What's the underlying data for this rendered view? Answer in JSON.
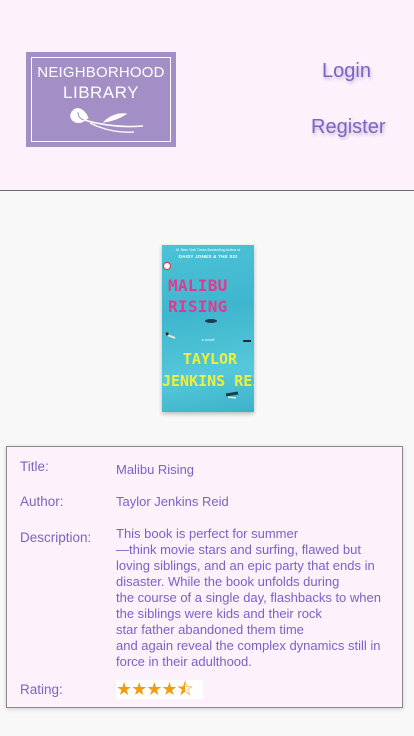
{
  "header": {
    "logo": {
      "line1": "NEIGHBORHOOD",
      "line2": "LIBRARY",
      "icon": "flower-icon"
    },
    "nav": {
      "login": "Login",
      "register": "Register"
    }
  },
  "book": {
    "cover": {
      "top_line": "#1 New York Times Bestselling Author of",
      "top_line2": "DAISY JONES & THE SIX",
      "title_line1": "MALIBU",
      "title_line2": "RISING",
      "small": "a novel",
      "author_line1": "TAYLOR",
      "author_line2": "JENKINS REID"
    },
    "labels": {
      "title": "Title:",
      "author": "Author:",
      "description": "Description:",
      "rating": "Rating:"
    },
    "title": "Malibu Rising",
    "author": "Taylor Jenkins Reid",
    "description": "This book is perfect for summer\n—think movie stars and surfing, flawed but loving siblings, and an epic party that ends in disaster. While the book unfolds during\n the course of a single day, flashbacks to when the siblings were kids and their rock\n star father abandoned them time\nand again reveal the complex dynamics still in force in their adulthood.",
    "rating": 4.5,
    "rating_stars": "★★★★⯪"
  },
  "colors": {
    "accent": "#8461c0",
    "header_bg": "#fdf2fc",
    "logo_bg": "#a38fc5",
    "star": "#f39c12"
  }
}
